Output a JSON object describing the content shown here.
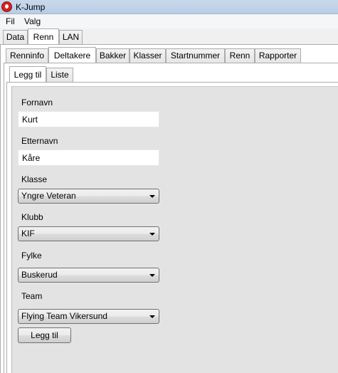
{
  "window": {
    "title": "K-Jump"
  },
  "menu": {
    "items": [
      "Fil",
      "Valg"
    ]
  },
  "top_tabs": [
    "Data",
    "Renn",
    "LAN"
  ],
  "renn_tabs": [
    "Renninfo",
    "Deltakere",
    "Bakker",
    "Klasser",
    "Startnummer",
    "Renn",
    "Rapporter"
  ],
  "deltakere_tabs": [
    "Legg til",
    "Liste"
  ],
  "form": {
    "fornavn_label": "Fornavn",
    "fornavn_value": "Kurt",
    "etternavn_label": "Etternavn",
    "etternavn_value": "Kåre",
    "klasse_label": "Klasse",
    "klasse_value": "Yngre Veteran",
    "klubb_label": "Klubb",
    "klubb_value": "KIF",
    "fylke_label": "Fylke",
    "fylke_value": "Buskerud",
    "team_label": "Team",
    "team_value": "Flying Team Vikersund",
    "submit_label": "Legg til"
  }
}
